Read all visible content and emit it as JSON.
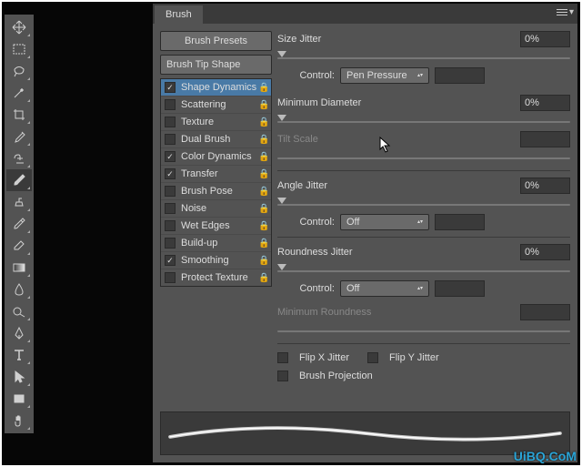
{
  "panel": {
    "title": "Brush",
    "presetsBtn": "Brush Presets",
    "tipShape": "Brush Tip Shape",
    "options": [
      {
        "label": "Shape Dynamics",
        "checked": true,
        "selected": true,
        "locked": true
      },
      {
        "label": "Scattering",
        "checked": false,
        "locked": true
      },
      {
        "label": "Texture",
        "checked": false,
        "locked": true
      },
      {
        "label": "Dual Brush",
        "checked": false,
        "locked": true
      },
      {
        "label": "Color Dynamics",
        "checked": true,
        "locked": true
      },
      {
        "label": "Transfer",
        "checked": true,
        "locked": true
      },
      {
        "label": "Brush Pose",
        "checked": false,
        "locked": true
      },
      {
        "label": "Noise",
        "checked": false,
        "locked": true
      },
      {
        "label": "Wet Edges",
        "checked": false,
        "locked": true
      },
      {
        "label": "Build-up",
        "checked": false,
        "locked": true
      },
      {
        "label": "Smoothing",
        "checked": true,
        "locked": true
      },
      {
        "label": "Protect Texture",
        "checked": false,
        "locked": true
      }
    ]
  },
  "settings": {
    "sizeJitter": {
      "label": "Size Jitter",
      "value": "0%",
      "control": "Pen Pressure"
    },
    "minDiameter": {
      "label": "Minimum Diameter",
      "value": "0%"
    },
    "tiltScale": {
      "label": "Tilt Scale"
    },
    "angleJitter": {
      "label": "Angle Jitter",
      "value": "0%",
      "control": "Off"
    },
    "roundnessJitter": {
      "label": "Roundness Jitter",
      "value": "0%",
      "control": "Off"
    },
    "minRoundness": {
      "label": "Minimum Roundness"
    },
    "controlLabel": "Control:",
    "flipX": "Flip X Jitter",
    "flipY": "Flip Y Jitter",
    "brushProjection": "Brush Projection"
  },
  "watermark": {
    "line1": "",
    "line2": "UiBQ.CoM"
  },
  "tools": [
    "move-tool",
    "rect-marquee-tool",
    "lasso-tool",
    "magic-wand-tool",
    "crop-tool",
    "eyedropper-tool",
    "healing-brush-tool",
    "brush-tool",
    "clone-stamp-tool",
    "history-brush-tool",
    "eraser-tool",
    "gradient-tool",
    "blur-tool",
    "dodge-tool",
    "pen-tool",
    "type-tool",
    "path-selection-tool",
    "rectangle-tool",
    "hand-tool"
  ]
}
